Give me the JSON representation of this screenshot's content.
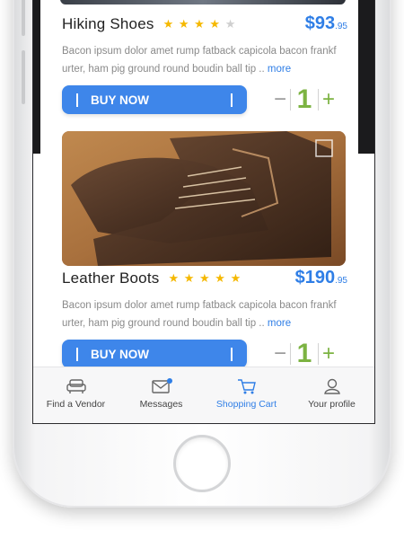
{
  "products": [
    {
      "name": "Hiking Shoes",
      "rating": 4,
      "max_rating": 5,
      "price_main": "$93",
      "price_cents": ".95",
      "description": "Bacon ipsum dolor amet rump fatback capicola bacon frankf urter, ham pig ground round boudin ball tip ..",
      "more_label": "more",
      "buy_label": "BUY NOW",
      "minus_label": "−",
      "quantity": "1",
      "plus_label": "+"
    },
    {
      "name": "Leather Boots",
      "rating": 5,
      "max_rating": 5,
      "price_main": "$190",
      "price_cents": ".95",
      "description": "Bacon ipsum dolor amet rump fatback capicola bacon frankf urter, ham pig ground round boudin ball tip ..",
      "more_label": "more",
      "buy_label": "BUY NOW",
      "minus_label": "−",
      "quantity": "1",
      "plus_label": "+"
    }
  ],
  "tabbar": {
    "tabs": [
      {
        "label": "Find a Vendor",
        "icon": "sofa-icon",
        "active": false
      },
      {
        "label": "Messages",
        "icon": "envelope-icon",
        "active": false,
        "badge": true
      },
      {
        "label": "Shopping Cart",
        "icon": "shopping-cart-icon",
        "active": true
      },
      {
        "label": "Your profile",
        "icon": "user-icon",
        "active": false
      }
    ]
  },
  "colors": {
    "accent": "#2f7ee6",
    "button": "#3e86ea",
    "star": "#f5b800",
    "quantity": "#7cb342"
  }
}
